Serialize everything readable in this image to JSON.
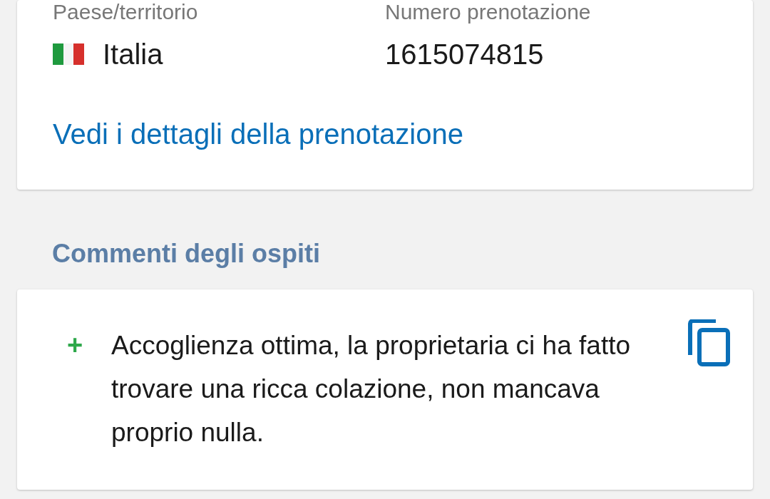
{
  "booking": {
    "country_label": "Paese/territorio",
    "country": "Italia",
    "number_label": "Numero prenotazione",
    "number": "1615074815",
    "details_link": "Vedi i dettagli della prenotazione"
  },
  "comments": {
    "heading": "Commenti degli ospiti",
    "items": [
      {
        "sign": "+",
        "text": "Accoglienza ottima, la proprietaria ci ha fatto trovare una ricca colazione, non mancava proprio nulla."
      }
    ]
  }
}
